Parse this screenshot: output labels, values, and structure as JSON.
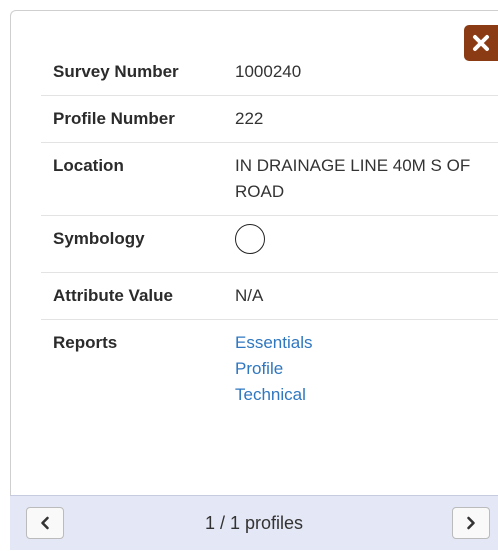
{
  "close": {
    "icon": "close-icon",
    "color": "#8b3b14"
  },
  "rows": {
    "survey_number": {
      "label": "Survey Number",
      "value": "1000240"
    },
    "profile_number": {
      "label": "Profile Number",
      "value": "222"
    },
    "location": {
      "label": "Location",
      "value": "IN DRAINAGE LINE 40M S OF ROAD"
    },
    "symbology": {
      "label": "Symbology",
      "icon": "circle-symbol-icon"
    },
    "attribute_value": {
      "label": "Attribute Value",
      "value": "N/A"
    },
    "reports": {
      "label": "Reports",
      "links": [
        "Essentials",
        "Profile",
        "Technical"
      ]
    }
  },
  "footer": {
    "page_text": "1 / 1 profiles",
    "prev_icon": "chevron-left-icon",
    "next_icon": "chevron-right-icon",
    "background": "#e4e7f5"
  },
  "link_color": "#2f77c0"
}
